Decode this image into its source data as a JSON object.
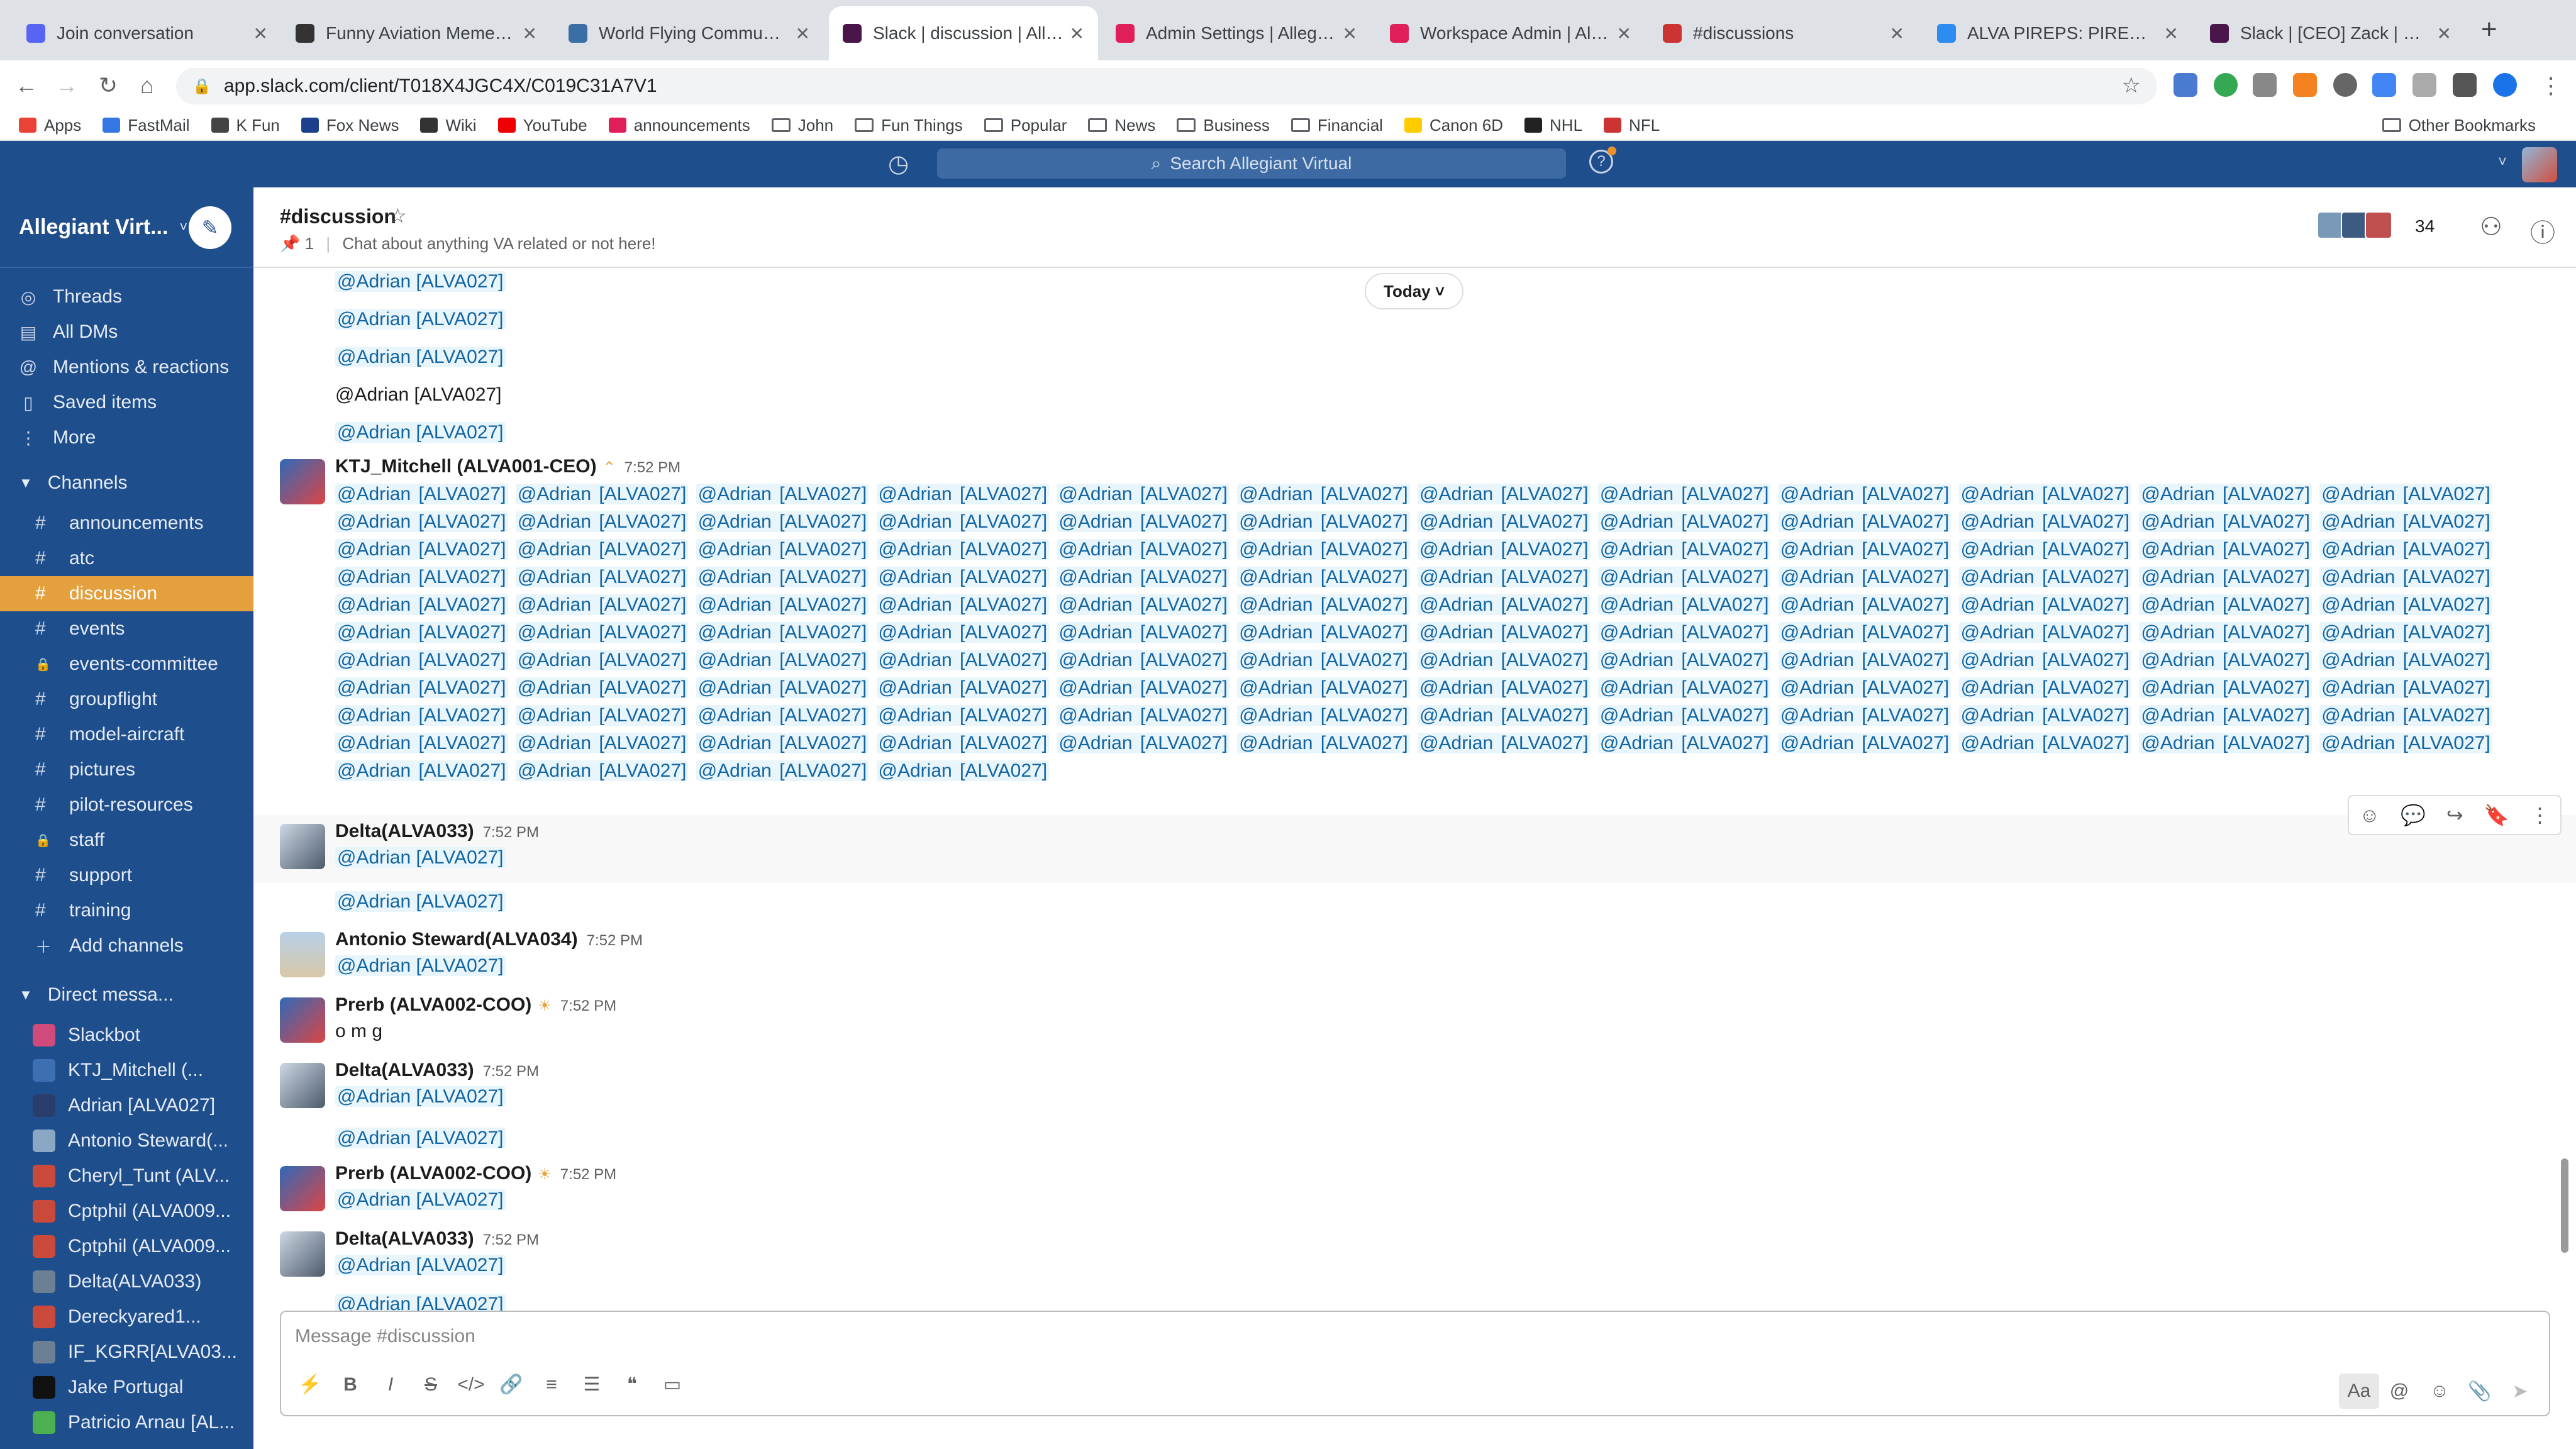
{
  "tabs": [
    {
      "title": "Join conversation",
      "color": "#5865f2"
    },
    {
      "title": "Funny Aviation Memes - Re",
      "color": "#333"
    },
    {
      "title": "World Flying Community - ",
      "color": "#3a6ea5"
    },
    {
      "title": "Slack | discussion | Allegia",
      "color": "#4a154b"
    },
    {
      "title": "Admin Settings | Allegiant V",
      "color": "#e01e5a"
    },
    {
      "title": "Workspace Admin | Allegia",
      "color": "#e01e5a"
    },
    {
      "title": "#discussions",
      "color": "#c33"
    },
    {
      "title": "ALVA PIREPS: PIREPS – Air",
      "color": "#2d8cf0"
    },
    {
      "title": "Slack | [CEO] Zack | El Al V",
      "color": "#4a154b"
    }
  ],
  "url": "app.slack.com/client/T018X4JGC4X/C019C31A7V1",
  "bookmarks": [
    "Apps",
    "FastMail",
    "K Fun",
    "Fox News",
    "Wiki",
    "YouTube",
    "announcements",
    "John",
    "Fun Things",
    "Popular",
    "News",
    "Business",
    "Financial",
    "Canon 6D",
    "NHL",
    "NFL"
  ],
  "other_bookmarks": "Other Bookmarks",
  "search_placeholder": "Search Allegiant Virtual",
  "workspace": "Allegiant Virt...",
  "nav": [
    {
      "icon": "threads-icon",
      "glyph": "◎",
      "label": "Threads"
    },
    {
      "icon": "dms-icon",
      "glyph": "▤",
      "label": "All DMs"
    },
    {
      "icon": "at-icon",
      "glyph": "@",
      "label": "Mentions & reactions"
    },
    {
      "icon": "bookmark-icon",
      "glyph": "▯",
      "label": "Saved items"
    },
    {
      "icon": "more-icon",
      "glyph": "⋮",
      "label": "More"
    }
  ],
  "channels_label": "Channels",
  "channels": [
    {
      "glyph": "#",
      "name": "announcements"
    },
    {
      "glyph": "#",
      "name": "atc"
    },
    {
      "glyph": "#",
      "name": "discussion",
      "active": true
    },
    {
      "glyph": "#",
      "name": "events"
    },
    {
      "glyph": "🔒",
      "name": "events-committee"
    },
    {
      "glyph": "#",
      "name": "groupflight"
    },
    {
      "glyph": "#",
      "name": "model-aircraft"
    },
    {
      "glyph": "#",
      "name": "pictures"
    },
    {
      "glyph": "#",
      "name": "pilot-resources"
    },
    {
      "glyph": "🔒",
      "name": "staff"
    },
    {
      "glyph": "#",
      "name": "support"
    },
    {
      "glyph": "#",
      "name": "training"
    }
  ],
  "add_channels": "Add channels",
  "dm_label": "Direct messa...",
  "dms": [
    {
      "name": "Slackbot",
      "color": "#d04a7b"
    },
    {
      "name": "KTJ_Mitchell (...",
      "color": "#3d6fb3"
    },
    {
      "name": "Adrian [ALVA027]",
      "color": "#2a3e6b"
    },
    {
      "name": "Antonio Steward(...",
      "color": "#8aa7c4"
    },
    {
      "name": "Cheryl_Tunt (ALV...",
      "color": "#c94a3a"
    },
    {
      "name": "Cptphil (ALVA009...",
      "color": "#c94a3a"
    },
    {
      "name": "Cptphil (ALVA009...",
      "color": "#c94a3a"
    },
    {
      "name": "Delta(ALVA033)",
      "color": "#6b7f95"
    },
    {
      "name": "Dereckyared1...",
      "color": "#c94a3a"
    },
    {
      "name": "IF_KGRR[ALVA03...",
      "color": "#6b7f95"
    },
    {
      "name": "Jake Portugal",
      "color": "#111"
    },
    {
      "name": "Patricio Arnau [AL...",
      "color": "#4caf50"
    }
  ],
  "channel": {
    "name": "#discussion",
    "pins": "1",
    "topic": "Chat about anything VA related or not here!",
    "members": "34"
  },
  "today": "Today",
  "mention": "@Adrian [ALVA027]",
  "plain_mention": "@Adrian [ALVA027]",
  "messages": [
    {
      "user": "KTJ_Mitchell (ALVA001-CEO)",
      "time": "7:52 PM"
    },
    {
      "user": "Delta(ALVA033)",
      "time": "7:52 PM"
    },
    {
      "user": "Antonio Steward(ALVA034)",
      "time": "7:52 PM"
    },
    {
      "user": "Prerb (ALVA002-COO)",
      "time": "7:52 PM",
      "text": "o m g"
    },
    {
      "user": "Delta(ALVA033)",
      "time": "7:52 PM"
    },
    {
      "user": "Prerb (ALVA002-COO)",
      "time": "7:52 PM"
    },
    {
      "user": "Delta(ALVA033)",
      "time": "7:52 PM"
    }
  ],
  "composer_placeholder": "Message #discussion",
  "composer_aa": "Aa"
}
